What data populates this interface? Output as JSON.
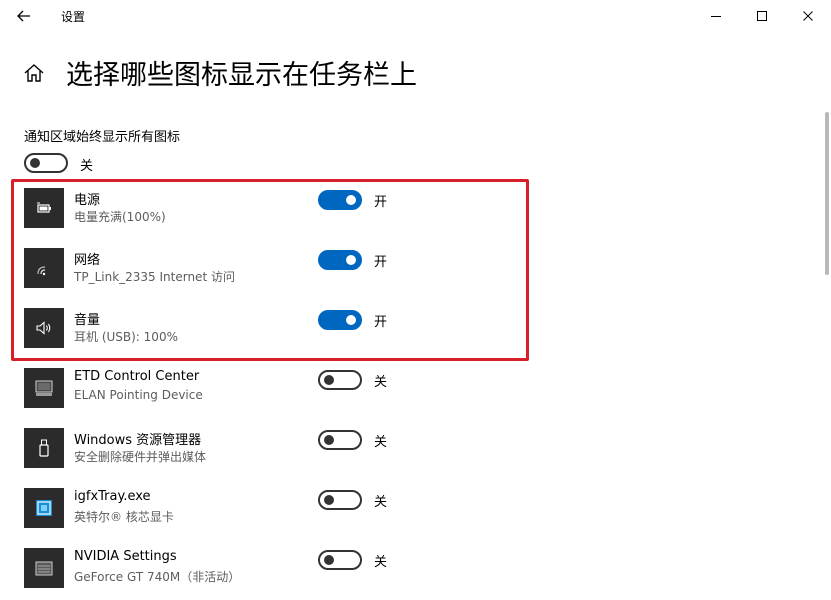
{
  "window": {
    "title": "设置"
  },
  "page": {
    "title": "选择哪些图标显示在任务栏上"
  },
  "always_show": {
    "label": "通知区域始终显示所有图标",
    "state_label": "关",
    "on": false
  },
  "items": [
    {
      "name": "电源",
      "desc": "电量充满(100%)",
      "state_label": "开",
      "on": true,
      "icon": "battery-icon"
    },
    {
      "name": "网络",
      "desc": "TP_Link_2335 Internet 访问",
      "state_label": "开",
      "on": true,
      "icon": "wifi-icon"
    },
    {
      "name": "音量",
      "desc": "耳机 (USB): 100%",
      "state_label": "开",
      "on": true,
      "icon": "speaker-icon"
    },
    {
      "name": "ETD Control Center",
      "desc": "ELAN Pointing Device",
      "state_label": "关",
      "on": false,
      "icon": "touchpad-icon"
    },
    {
      "name": "Windows 资源管理器",
      "desc": "安全删除硬件并弹出媒体",
      "state_label": "关",
      "on": false,
      "icon": "usb-drive-icon"
    },
    {
      "name": "igfxTray.exe",
      "desc": "英特尔® 核芯显卡",
      "state_label": "关",
      "on": false,
      "icon": "intel-graphics-icon"
    },
    {
      "name": "NVIDIA Settings",
      "desc": "GeForce GT 740M（非活动）",
      "state_label": "关",
      "on": false,
      "icon": "nvidia-icon"
    }
  ]
}
